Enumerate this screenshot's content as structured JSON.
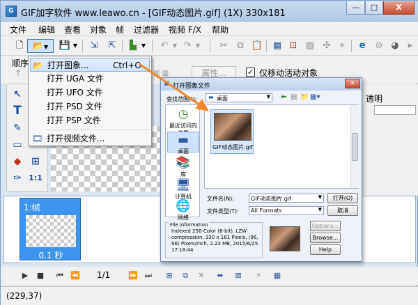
{
  "window": {
    "title": "GIF加字软件 www.leawo.cn - [GIF动态图片.gif] (1X) 330x181",
    "icon_label": "G",
    "controls": [
      "—",
      "□",
      "X"
    ]
  },
  "menubar": [
    "文件",
    "编辑",
    "查看",
    "对象",
    "帧",
    "过滤器",
    "视频 F/X",
    "帮助"
  ],
  "toolbar_icons": [
    "new-icon",
    "open-icon",
    "chevron-down-icon",
    "save-icon",
    "chevron-down-icon",
    "import-icon",
    "export-icon",
    "color-icon",
    "chevron-down-icon",
    "undo-icon",
    "chevron-down-icon",
    "redo-icon",
    "chevron-down-icon",
    "cut-icon",
    "copy-icon",
    "paste-icon",
    "tool1-icon",
    "tool2-icon",
    "tool3-icon",
    "tool4-icon",
    "tool5-icon",
    "ie-icon",
    "tool6-icon",
    "tool7-icon",
    "tool8-icon"
  ],
  "row2": {
    "order_label": "顺序",
    "properties_label": "属性...",
    "move_active_label": "仅移动活动对象",
    "move_active_checked": true,
    "transparency_label": "透明"
  },
  "tools": [
    [
      "↖",
      "T"
    ],
    [
      "✎",
      "▭"
    ],
    [
      "▭",
      "⤡"
    ],
    [
      "◆",
      "⊞"
    ],
    [
      "✑",
      "1:1"
    ],
    [
      "◔",
      "◔"
    ]
  ],
  "dropdown": {
    "items": [
      {
        "label": "打开图象...",
        "shortcut": "Ctrl+O",
        "icon": "open-icon",
        "highlighted": true
      },
      {
        "label": "打开 UGA 文件",
        "shortcut": "",
        "icon": "",
        "highlighted": false
      },
      {
        "label": "打开 UFO 文件",
        "shortcut": "",
        "icon": "",
        "highlighted": false
      },
      {
        "label": "打开 PSD 文件",
        "shortcut": "",
        "icon": "",
        "highlighted": false
      },
      {
        "label": "打开 PSP 文件",
        "shortcut": "",
        "icon": "",
        "highlighted": false
      },
      {
        "label": "打开视频文件...",
        "shortcut": "",
        "icon": "video-icon",
        "highlighted": false
      }
    ]
  },
  "dialog": {
    "title": "打开图象文件",
    "look_in_label": "查找范围(I):",
    "look_in_value": "桌面",
    "places": [
      "最近访问的位置",
      "桌面",
      "库",
      "计算机",
      "网络"
    ],
    "file": {
      "name": "GIF动态图片.gif"
    },
    "filename_label": "文件名(N):",
    "filename_value": "GIF动态图片.gif",
    "filetype_label": "文件类型(T):",
    "filetype_value": "All Formats",
    "open_button": "打开(O)",
    "cancel_button": "取消",
    "info_title": "File information",
    "info_text": "Indexed 256-Color (8-bit), LZW compression, 330 x 181 Pixels, (96, 96) Pixels/Inch, 2.23 MB, 2015/6/25 17:18:44",
    "options_button": "Options...",
    "browse_button": "Browse...",
    "help_button": "Help"
  },
  "frames": [
    {
      "label": "1:帧",
      "time": "0.1 秒"
    }
  ],
  "playbar": {
    "counter": "1/1"
  },
  "status": {
    "coords": "(229,37)"
  },
  "colors": {
    "accent": "#3d94ee",
    "arrow": "#f08a2a",
    "highlight": "#cfe2fb"
  }
}
